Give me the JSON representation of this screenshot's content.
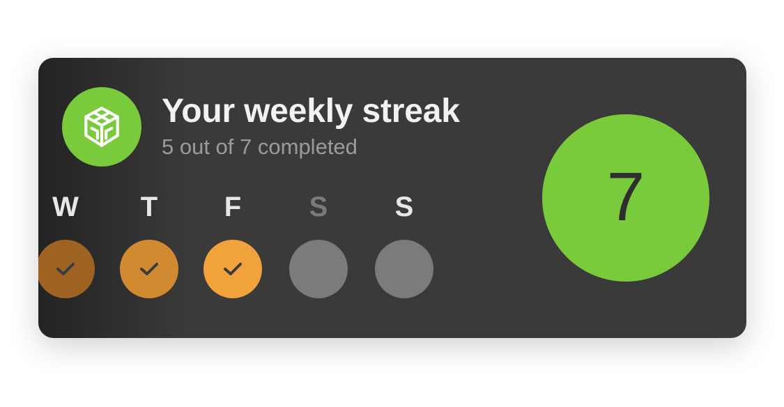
{
  "card": {
    "title": "Your weekly streak",
    "subtitle": "5 out of 7 completed"
  },
  "streak": {
    "count": "7"
  },
  "days": [
    {
      "label": "W",
      "status": "completed"
    },
    {
      "label": "T",
      "status": "completed"
    },
    {
      "label": "F",
      "status": "completed"
    },
    {
      "label": "S",
      "status": "pending"
    },
    {
      "label": "S",
      "status": "pending"
    }
  ],
  "colors": {
    "card_bg": "#3a3a3a",
    "accent_green": "#7acb3c",
    "completed_orange": "#f2a23b",
    "pending_gray": "#7b7b7b",
    "text_primary": "#f2f2f2",
    "text_secondary": "#9b9b9b"
  },
  "icons": {
    "app_badge": "cube-icon",
    "completed_day": "check-icon"
  }
}
